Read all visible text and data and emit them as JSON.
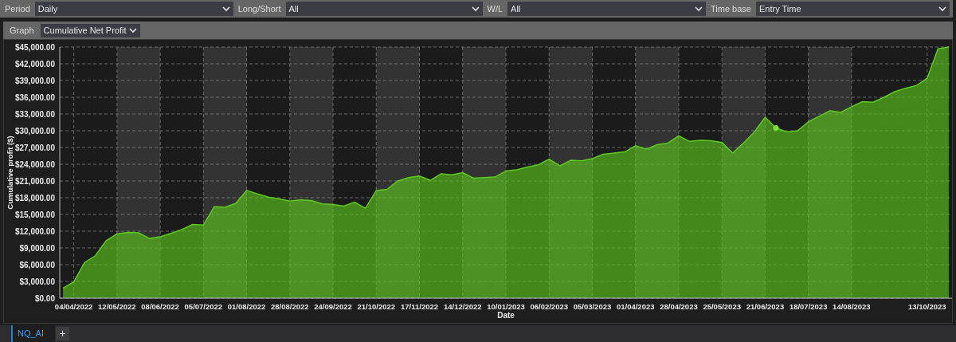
{
  "filters": [
    {
      "label": "Period",
      "value": "Daily"
    },
    {
      "label": "Long/Short",
      "value": "All"
    },
    {
      "label": "W/L",
      "value": "All"
    },
    {
      "label": "Time base",
      "value": "Entry Time"
    }
  ],
  "graph": {
    "label": "Graph",
    "value": "Cumulative Net Profit"
  },
  "chart_data": {
    "type": "area",
    "xlabel": "Date",
    "ylabel": "Cumulative profit ($)",
    "categories": [
      null,
      "04/04/2022",
      null,
      null,
      null,
      "12/05/2022",
      null,
      null,
      null,
      "08/06/2022",
      null,
      null,
      null,
      "05/07/2022",
      null,
      null,
      null,
      "01/08/2022",
      null,
      null,
      null,
      "28/08/2022",
      null,
      null,
      null,
      "24/09/2022",
      null,
      null,
      null,
      "21/10/2022",
      null,
      null,
      null,
      "17/11/2022",
      null,
      null,
      null,
      "14/12/2022",
      null,
      null,
      null,
      "10/01/2023",
      null,
      null,
      null,
      "06/02/2023",
      null,
      null,
      null,
      "05/03/2023",
      null,
      null,
      null,
      "01/04/2023",
      null,
      null,
      null,
      "28/04/2023",
      null,
      null,
      null,
      "25/05/2023",
      null,
      null,
      null,
      "21/06/2023",
      null,
      null,
      null,
      "18/07/2023",
      null,
      null,
      null,
      "14/08/2023",
      null,
      null,
      null,
      null,
      null,
      null,
      "13/10/2023",
      null,
      null
    ],
    "series": [
      {
        "color": "#5ecb1e",
        "values": [
          1800,
          2900,
          6400,
          7600,
          10300,
          11500,
          11800,
          11700,
          10700,
          11000,
          11600,
          12300,
          13200,
          13100,
          16400,
          16300,
          17000,
          19300,
          18700,
          18100,
          17800,
          17400,
          17600,
          17500,
          16900,
          16800,
          16500,
          17200,
          16100,
          19300,
          19500,
          21000,
          21600,
          21900,
          21100,
          22300,
          22100,
          22500,
          21500,
          21600,
          21700,
          22800,
          23000,
          23500,
          23900,
          24900,
          23700,
          24700,
          24600,
          25000,
          25800,
          26000,
          26200,
          27300,
          26700,
          27500,
          27800,
          29100,
          28100,
          28300,
          28200,
          27900,
          26000,
          27800,
          29800,
          32400,
          30500,
          29800,
          30000,
          31600,
          32600,
          33600,
          33300,
          34300,
          35200,
          35100,
          36000,
          37000,
          37600,
          38100,
          39400,
          44700,
          45000
        ]
      }
    ],
    "ylim": [
      0,
      45000
    ],
    "yticks": [
      {
        "value": 0,
        "label": "$0.00"
      },
      {
        "value": 3000,
        "label": "$3,000.00"
      },
      {
        "value": 6000,
        "label": "$6,000.00"
      },
      {
        "value": 9000,
        "label": "$9,000.00"
      },
      {
        "value": 12000,
        "label": "$12,000.00"
      },
      {
        "value": 15000,
        "label": "$15,000.00"
      },
      {
        "value": 18000,
        "label": "$18,000.00"
      },
      {
        "value": 21000,
        "label": "$21,000.00"
      },
      {
        "value": 24000,
        "label": "$24,000.00"
      },
      {
        "value": 27000,
        "label": "$27,000.00"
      },
      {
        "value": 30000,
        "label": "$30,000.00"
      },
      {
        "value": 33000,
        "label": "$33,000.00"
      },
      {
        "value": 36000,
        "label": "$36,000.00"
      },
      {
        "value": 39000,
        "label": "$39,000.00"
      },
      {
        "value": 42000,
        "label": "$42,000.00"
      },
      {
        "value": 45000,
        "label": "$45,000.00"
      }
    ],
    "grid": true
  },
  "tabs": [
    {
      "label": "NQ_AI",
      "selected": true
    }
  ],
  "add_tab": "+"
}
